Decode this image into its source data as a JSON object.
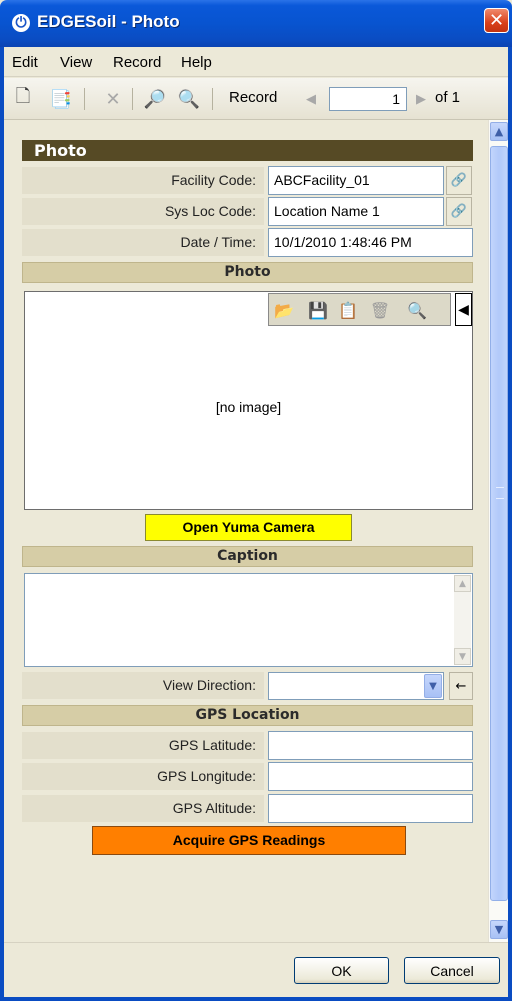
{
  "window": {
    "title": "EDGESoil - Photo",
    "close_glyph": "✕",
    "app_icon": "power-icon"
  },
  "menu": {
    "items": [
      "Edit",
      "View",
      "Record",
      "Help"
    ]
  },
  "toolbar": {
    "icons": [
      "new-record-icon",
      "copy-record-icon",
      "delete-icon",
      "find-icon",
      "zoom-out-icon"
    ],
    "record_label": "Record",
    "record_value": "1",
    "of_label": "of 1"
  },
  "form": {
    "header": "Photo",
    "fields": {
      "facility_code": {
        "label": "Facility Code:",
        "value": "ABCFacility_01"
      },
      "sys_loc_code": {
        "label": "Sys Loc Code:",
        "value": "Location Name 1"
      },
      "date_time": {
        "label": "Date / Time:",
        "value": "10/1/2010 1:48:46 PM"
      }
    },
    "photo_section": {
      "title": "Photo",
      "no_image": "[no image]"
    },
    "yuma_button": "Open Yuma Camera",
    "caption_section": {
      "title": "Caption",
      "value": ""
    },
    "view_direction": {
      "label": "View Direction:",
      "value": ""
    },
    "gps_section": {
      "title": "GPS Location",
      "latitude_label": "GPS Latitude:",
      "latitude_value": "",
      "longitude_label": "GPS Longitude:",
      "longitude_value": "",
      "altitude_label": "GPS Altitude:",
      "altitude_value": ""
    },
    "gps_button": "Acquire GPS Readings"
  },
  "buttons": {
    "ok": "OK",
    "cancel": "Cancel"
  },
  "colors": {
    "header_dark": "#564a25",
    "section_tan": "#d6cda6",
    "yuma_yellow": "#ffff00",
    "gps_orange": "#ff7f00",
    "xp_blue": "#0a4cc2"
  }
}
